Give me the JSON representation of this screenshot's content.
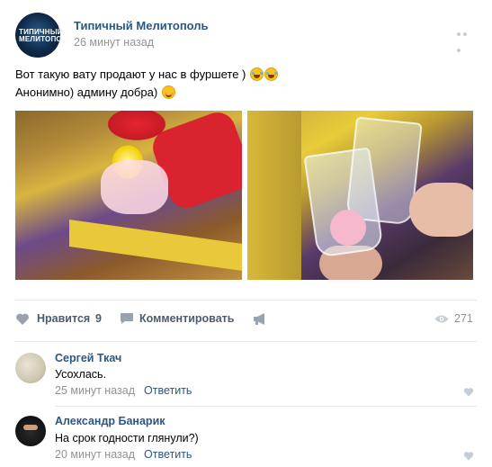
{
  "post": {
    "group_name": "Типичный Мелитополь",
    "group_logo_text": "ТИПИЧНЫЙ МЕЛИТОПОЛЬ",
    "time": "26 минут назад",
    "text_line1": "Вот такую вату продают у нас в фуршете )",
    "text_line2": "Анонимно) админу добра)"
  },
  "actions": {
    "like_label": "Нравится",
    "like_count": "9",
    "comment_label": "Комментировать",
    "views": "271"
  },
  "comments": [
    {
      "author": "Сергей Ткач",
      "text": "Усохлась.",
      "time": "25 минут назад",
      "reply": "Ответить"
    },
    {
      "author": "Александр Банарик",
      "text": "На срок годности глянули?)",
      "time": "20 минут назад",
      "reply": "Ответить"
    }
  ],
  "colors": {
    "link": "#2a5885",
    "muted": "#939393",
    "action": "#4a5c71",
    "divider": "#e7e8ec"
  }
}
